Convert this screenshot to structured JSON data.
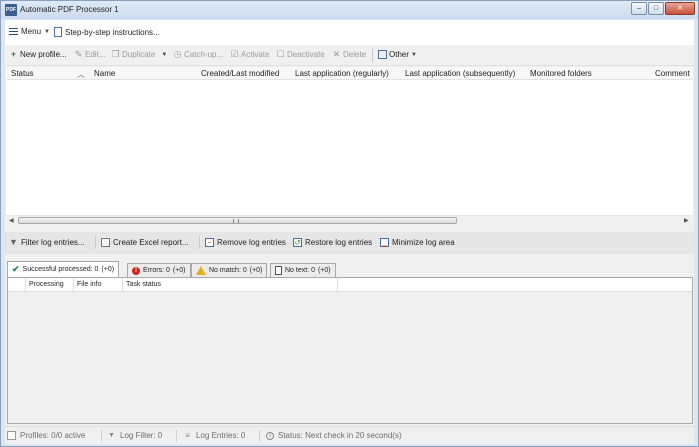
{
  "window": {
    "title": "Automatic PDF Processor 1",
    "controls": {
      "minimize": "–",
      "maximize": "□",
      "close": "✕"
    }
  },
  "menubar": {
    "menu_label": "Menu",
    "instructions_label": "Step-by-step instructions..."
  },
  "toolbar": {
    "new_profile": "New profile...",
    "edit": "Edit...",
    "duplicate": "Duplicate",
    "catchup": "Catch-up...",
    "activate": "Activate",
    "deactivate": "Deactivate",
    "delete": "Delete",
    "other": "Other"
  },
  "profiles_table": {
    "columns": [
      "Status",
      "Name",
      "Created/Last modified",
      "Last application (regularly)",
      "Last application (subsequently)",
      "Monitored folders",
      "Comment"
    ],
    "rows": []
  },
  "log_toolbar": {
    "filter": "Filter log entries...",
    "excel": "Create Excel report...",
    "remove": "Remove log entries",
    "restore": "Restore log entries",
    "minimize": "Minimize log area"
  },
  "log_tabs": [
    {
      "label": "Successful processed: 0",
      "delta": "(+0)",
      "icon": "checkmark-icon"
    },
    {
      "label": "Errors: 0",
      "delta": "(+0)",
      "icon": "error-icon"
    },
    {
      "label": "No match: 0",
      "delta": "(+0)",
      "icon": "warning-icon"
    },
    {
      "label": "No text: 0",
      "delta": "(+0)",
      "icon": "page-icon"
    }
  ],
  "log_table": {
    "columns": [
      "Processing",
      "File info",
      "Task status"
    ]
  },
  "statusbar": {
    "profiles": "Profiles: 0/0 active",
    "log_filter": "Log Filter: 0",
    "log_entries": "Log Entries: 0",
    "status": "Status: Next check in 20 second(s)"
  },
  "colors": {
    "accent": "#2c4b6e",
    "error": "#d0261b",
    "warning": "#e3b21a",
    "success": "#2b8a3e"
  }
}
